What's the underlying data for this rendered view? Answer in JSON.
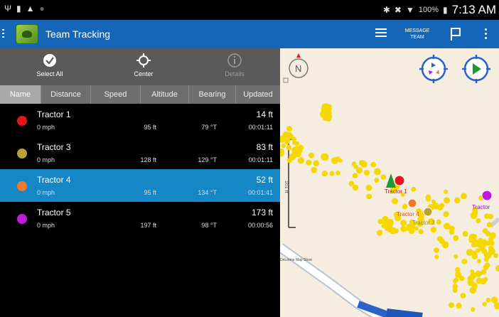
{
  "status_bar": {
    "battery": "100%",
    "time": "7:13 AM"
  },
  "app_bar": {
    "title": "Team Tracking",
    "message_line1": "MESSAGE",
    "message_line2": "TEAM"
  },
  "actions": [
    {
      "label": "Select All",
      "icon": "check-circle-icon",
      "enabled": true
    },
    {
      "label": "Center",
      "icon": "crosshair-icon",
      "enabled": true
    },
    {
      "label": "Details",
      "icon": "info-icon",
      "enabled": false
    }
  ],
  "columns": [
    "Name",
    "Distance",
    "Speed",
    "Altitude",
    "Bearing",
    "Updated"
  ],
  "active_column": "Name",
  "rows": [
    {
      "name": "Tractor 1",
      "color": "#e8141c",
      "distance": "14 ft",
      "speed": "0 mph",
      "altitude": "95 ft",
      "bearing": "79 °T",
      "updated": "00:01:11",
      "selected": false
    },
    {
      "name": "Tractor 3",
      "color": "#b8a232",
      "distance": "83 ft",
      "speed": "0 mph",
      "altitude": "128 ft",
      "bearing": "129 °T",
      "updated": "00:01:11",
      "selected": false
    },
    {
      "name": "Tractor 4",
      "color": "#f07a28",
      "distance": "52 ft",
      "speed": "0 mph",
      "altitude": "95 ft",
      "bearing": "134 °T",
      "updated": "00:01:41",
      "selected": true
    },
    {
      "name": "Tractor 5",
      "color": "#c01ad8",
      "distance": "173 ft",
      "speed": "0 mph",
      "altitude": "197 ft",
      "bearing": "98 °T",
      "updated": "00:00:56",
      "selected": false
    }
  ],
  "map": {
    "compass_label": "N",
    "scale_label": "161 ft",
    "attribution": "DeLorme Map Store",
    "labels": {
      "t1": "Tractor 1",
      "t4": "Tractor 4",
      "t3": "Tractor 3",
      "t5": "Tractor"
    },
    "track_color": "#f5d800"
  }
}
